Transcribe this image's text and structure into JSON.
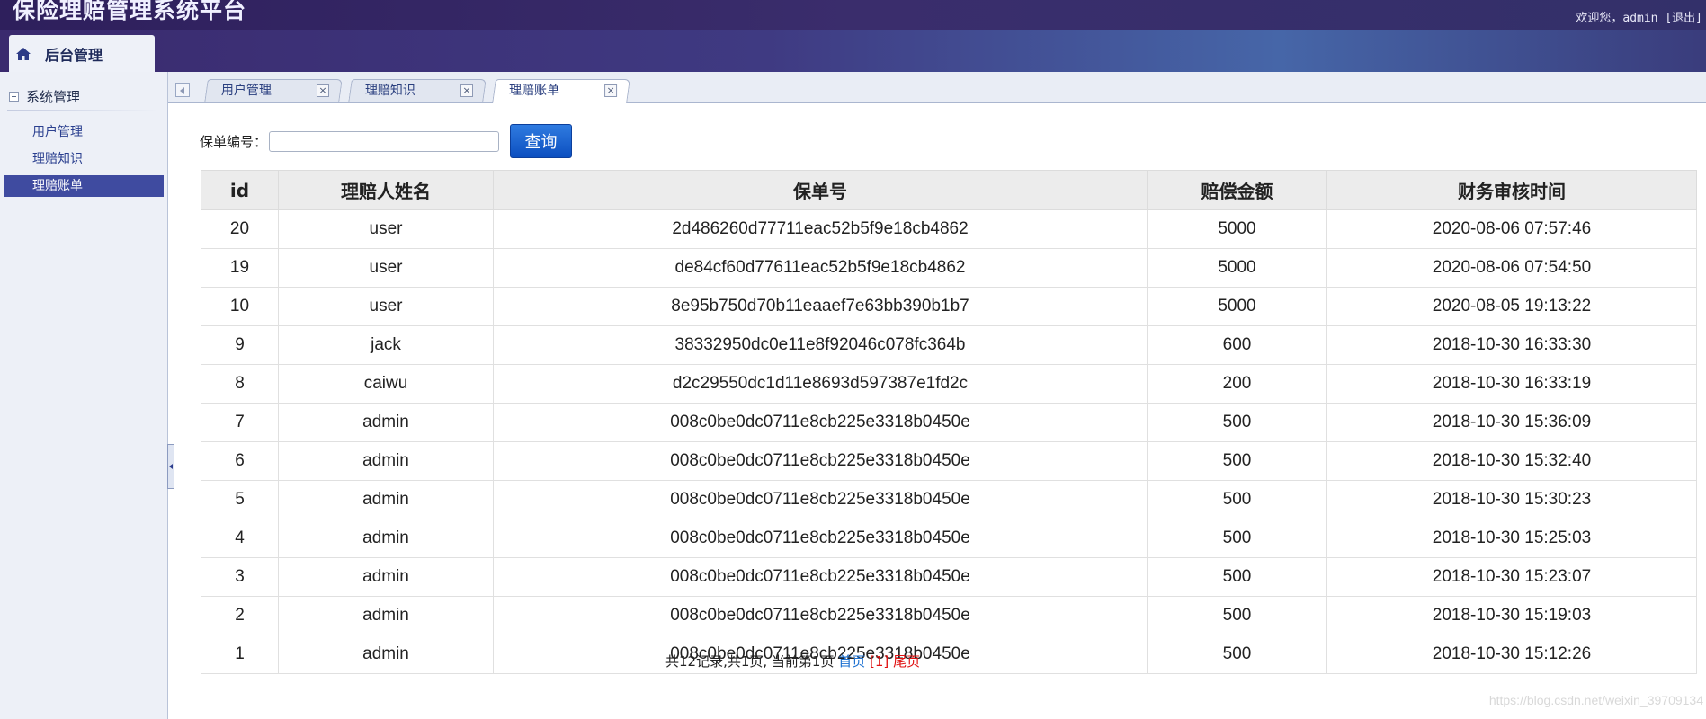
{
  "header": {
    "app_title": "保险理赔管理系统平台",
    "welcome_prefix": "欢迎您，admin ",
    "logout_label": "[退出]",
    "main_tab_label": "后台管理"
  },
  "sidebar": {
    "group_label": "系统管理",
    "items": [
      {
        "label": "用户管理"
      },
      {
        "label": "理赔知识"
      },
      {
        "label": "理赔账单"
      }
    ]
  },
  "tabs": [
    {
      "label": "用户管理",
      "close": "×"
    },
    {
      "label": "理赔知识",
      "close": "×"
    },
    {
      "label": "理赔账单",
      "close": "×"
    }
  ],
  "search": {
    "label": "保单编号：",
    "value": "",
    "placeholder": "",
    "button_label": "查询"
  },
  "table": {
    "columns": [
      "id",
      "理赔人姓名",
      "保单号",
      "赔偿金额",
      "财务审核时间"
    ],
    "rows": [
      [
        "20",
        "user",
        "2d486260d77711eac52b5f9e18cb4862",
        "5000",
        "2020-08-06 07:57:46"
      ],
      [
        "19",
        "user",
        "de84cf60d77611eac52b5f9e18cb4862",
        "5000",
        "2020-08-06 07:54:50"
      ],
      [
        "10",
        "user",
        "8e95b750d70b11eaaef7e63bb390b1b7",
        "5000",
        "2020-08-05 19:13:22"
      ],
      [
        "9",
        "jack",
        "38332950dc0e11e8f92046c078fc364b",
        "600",
        "2018-10-30 16:33:30"
      ],
      [
        "8",
        "caiwu",
        "d2c29550dc1d11e8693d597387e1fd2c",
        "200",
        "2018-10-30 16:33:19"
      ],
      [
        "7",
        "admin",
        "008c0be0dc0711e8cb225e3318b0450e",
        "500",
        "2018-10-30 15:36:09"
      ],
      [
        "6",
        "admin",
        "008c0be0dc0711e8cb225e3318b0450e",
        "500",
        "2018-10-30 15:32:40"
      ],
      [
        "5",
        "admin",
        "008c0be0dc0711e8cb225e3318b0450e",
        "500",
        "2018-10-30 15:30:23"
      ],
      [
        "4",
        "admin",
        "008c0be0dc0711e8cb225e3318b0450e",
        "500",
        "2018-10-30 15:25:03"
      ],
      [
        "3",
        "admin",
        "008c0be0dc0711e8cb225e3318b0450e",
        "500",
        "2018-10-30 15:23:07"
      ],
      [
        "2",
        "admin",
        "008c0be0dc0711e8cb225e3318b0450e",
        "500",
        "2018-10-30 15:19:03"
      ],
      [
        "1",
        "admin",
        "008c0be0dc0711e8cb225e3318b0450e",
        "500",
        "2018-10-30 15:12:26"
      ]
    ]
  },
  "pager": {
    "summary": "共12记录,共1页, 当前第1页 ",
    "first_label": "首页",
    "current_label": " [1] ",
    "last_label": "尾页"
  },
  "watermark": "https://blog.csdn.net/weixin_39709134",
  "colors": {
    "header_bg": "#3f3a82",
    "sidebar_active": "#3f4ba0",
    "button_blue": "#0c4fc0",
    "pager_link": "#1a6fd0",
    "pager_red": "#e01010"
  }
}
